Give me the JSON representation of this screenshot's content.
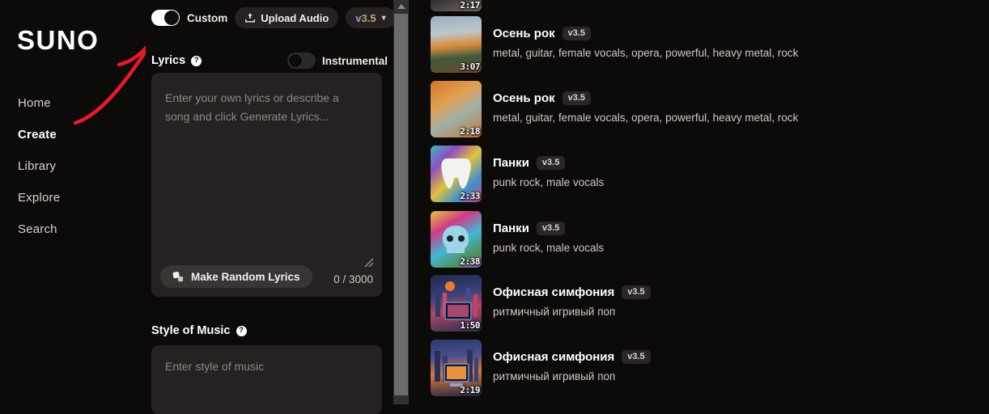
{
  "app": {
    "logo": "SUNO",
    "background": "#0d0a0a"
  },
  "sidebar": {
    "items": [
      {
        "label": "Home",
        "active": false
      },
      {
        "label": "Create",
        "active": true
      },
      {
        "label": "Library",
        "active": false
      },
      {
        "label": "Explore",
        "active": false
      },
      {
        "label": "Search",
        "active": false
      }
    ]
  },
  "annotation": {
    "type": "red-arrow",
    "color": "#e8192c"
  },
  "create_panel": {
    "custom_toggle": {
      "label": "Custom",
      "state": "on"
    },
    "upload_audio": {
      "label": "Upload Audio",
      "icon": "upload-icon"
    },
    "version_select": {
      "label": "v3.5",
      "icon": "chevron-down-icon"
    },
    "lyrics": {
      "title": "Lyrics",
      "help_icon": "question-mark-icon",
      "placeholder": "Enter your own lyrics or describe a song and click Generate Lyrics...",
      "value": "",
      "random_button": {
        "label": "Make Random Lyrics",
        "icon": "dice-icon"
      },
      "char_count": "0 / 3000",
      "resize_handle": "resize-grip-icon"
    },
    "instrumental_toggle": {
      "label": "Instrumental",
      "state": "off"
    },
    "style_of_music": {
      "title": "Style of Music",
      "help_icon": "question-mark-icon",
      "placeholder": "Enter style of music",
      "value": ""
    }
  },
  "scrollbar": {
    "up_arrow": "scroll-up-arrow-icon",
    "position": "top"
  },
  "song_list": {
    "partial_top_item": {
      "duration": "2:17"
    },
    "items": [
      {
        "title": "Осень рок",
        "version": "v3.5",
        "tags": "metal, guitar, female vocals, opera, powerful, heavy metal, rock",
        "duration": "3:07",
        "art": "autumn-tree-lake"
      },
      {
        "title": "Осень рок",
        "version": "v3.5",
        "tags": "metal, guitar, female vocals, opera, powerful, heavy metal, rock",
        "duration": "2:18",
        "art": "autumn-forest-river"
      },
      {
        "title": "Панки",
        "version": "v3.5",
        "tags": "punk rock, male vocals",
        "duration": "2:33",
        "art": "graffiti-tooth"
      },
      {
        "title": "Панки",
        "version": "v3.5",
        "tags": "punk rock, male vocals",
        "duration": "2:38",
        "art": "blue-skull"
      },
      {
        "title": "Офисная симфония",
        "version": "v3.5",
        "tags": "ритмичный игривый поп",
        "duration": "1:50",
        "art": "city-monitor-sunset"
      },
      {
        "title": "Офисная симфония",
        "version": "v3.5",
        "tags": "ритмичный игривый поп",
        "duration": "2:19",
        "art": "city-monitor-dusk"
      }
    ]
  }
}
